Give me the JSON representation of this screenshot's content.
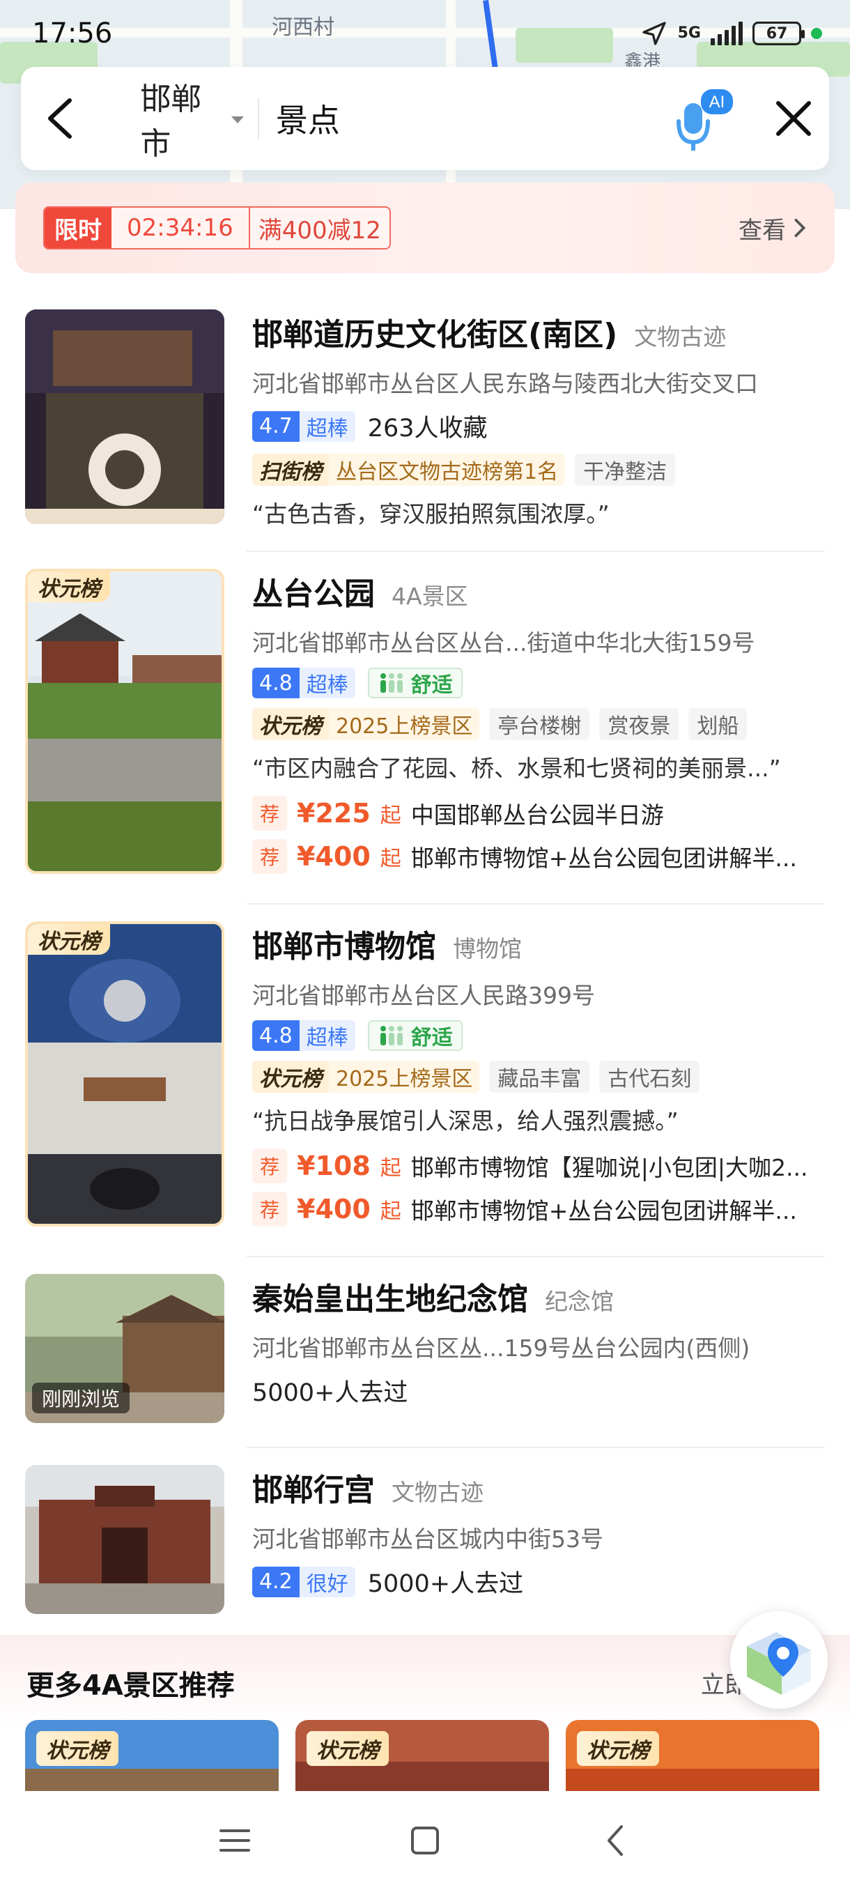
{
  "status_bar": {
    "time": "17:56",
    "network": "5G",
    "battery": "67"
  },
  "map": {
    "labels": [
      "河西村",
      "鑫港"
    ]
  },
  "search": {
    "city": "邯郸市",
    "query": "景点"
  },
  "promo": {
    "badge": "限时",
    "timer": "02:34:16",
    "offer": "满400减12",
    "view": "查看"
  },
  "items": [
    {
      "title": "邯郸道历史文化街区(南区)",
      "category": "文物古迹",
      "address": "河北省邯郸市丛台区人民东路与陵西北大街交叉口",
      "score": "4.7",
      "score_word": "超棒",
      "collects": "263人收藏",
      "rank_name": "扫街榜",
      "rank_value": "丛台区文物古迹榜第1名",
      "tags": [
        "干净整洁"
      ],
      "quote": "“古色古香，穿汉服拍照氛围浓厚。”"
    },
    {
      "title": "丛台公园",
      "category": "4A景区",
      "address": "河北省邯郸市丛台区丛台...街道中华北大街159号",
      "ribbon": "状元榜",
      "score": "4.8",
      "score_word": "超棒",
      "comfort": "舒适",
      "rank_name": "状元榜",
      "rank_value": "2025上榜景区",
      "tags": [
        "亭台楼榭",
        "赏夜景",
        "划船"
      ],
      "quote": "“市区内融合了花园、桥、水景和七贤祠的美丽景...”",
      "recs": [
        {
          "badge": "荐",
          "price": "¥225",
          "from": "起",
          "name": "中国邯郸丛台公园半日游"
        },
        {
          "badge": "荐",
          "price": "¥400",
          "from": "起",
          "name": "邯郸市博物馆+丛台公园包团讲解半..."
        }
      ]
    },
    {
      "title": "邯郸市博物馆",
      "category": "博物馆",
      "address": "河北省邯郸市丛台区人民路399号",
      "ribbon": "状元榜",
      "score": "4.8",
      "score_word": "超棒",
      "comfort": "舒适",
      "rank_name": "状元榜",
      "rank_value": "2025上榜景区",
      "tags": [
        "藏品丰富",
        "古代石刻"
      ],
      "quote": "“抗日战争展馆引人深思，给人强烈震撼。”",
      "recs": [
        {
          "badge": "荐",
          "price": "¥108",
          "from": "起",
          "name": "邯郸市博物馆【猩咖说|小包团|大咖2..."
        },
        {
          "badge": "荐",
          "price": "¥400",
          "from": "起",
          "name": "邯郸市博物馆+丛台公园包团讲解半..."
        }
      ]
    },
    {
      "title": "秦始皇出生地纪念馆",
      "category": "纪念馆",
      "address": "河北省邯郸市丛台区丛...159号丛台公园内(西侧)",
      "recent": "刚刚浏览",
      "visits": "5000+人去过"
    },
    {
      "title": "邯郸行宫",
      "category": "文物古迹",
      "address": "河北省邯郸市丛台区城内中街53号",
      "score": "4.2",
      "score_word": "很好",
      "visits": "5000+人去过"
    }
  ],
  "more": {
    "title": "更多4A景区推荐",
    "link": "立即",
    "cards": [
      "状元榜",
      "状元榜",
      "状元榜"
    ]
  },
  "colors": {
    "accent_blue": "#3c78f6",
    "promo_red": "#f0483b",
    "price_orange": "#f05a2b",
    "comfort_green": "#2da64b"
  }
}
